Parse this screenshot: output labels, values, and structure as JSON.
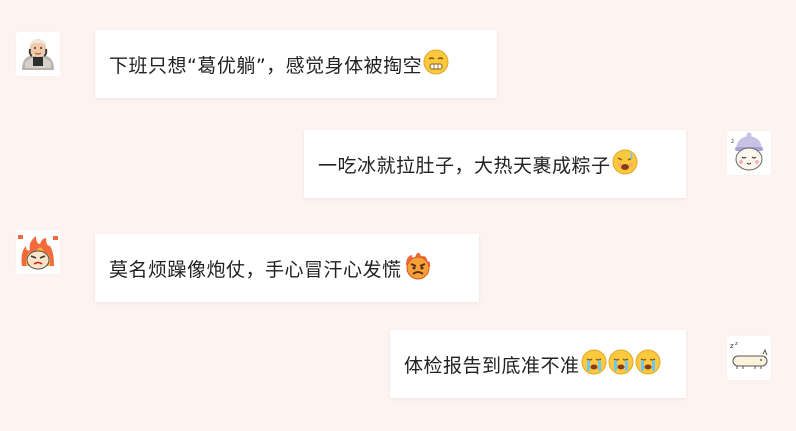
{
  "colors": {
    "background": "#fdf3f1",
    "bubble": "#ffffff",
    "text": "#222222",
    "emoji_yellow": "#fbc93d"
  },
  "messages": [
    {
      "side": "left",
      "avatar_icon": "bald-man-avatar-icon",
      "text": "下班只想“葛优躺”，感觉身体被掏空",
      "emojis": [
        "grimacing-face-icon"
      ]
    },
    {
      "side": "right",
      "avatar_icon": "sleepy-cat-hat-avatar-icon",
      "text": "一吃冰就拉肚子，大热天裹成粽子",
      "emojis": [
        "sick-face-icon"
      ]
    },
    {
      "side": "left",
      "avatar_icon": "angry-fire-avatar-icon",
      "text": "莫名烦躁像炮仗，手心冒汗心发慌",
      "emojis": [
        "angry-face-icon"
      ]
    },
    {
      "side": "right",
      "avatar_icon": "lying-creature-avatar-icon",
      "text": "体检报告到底准不准",
      "emojis": [
        "crying-face-icon",
        "crying-face-icon",
        "crying-face-icon"
      ]
    }
  ]
}
